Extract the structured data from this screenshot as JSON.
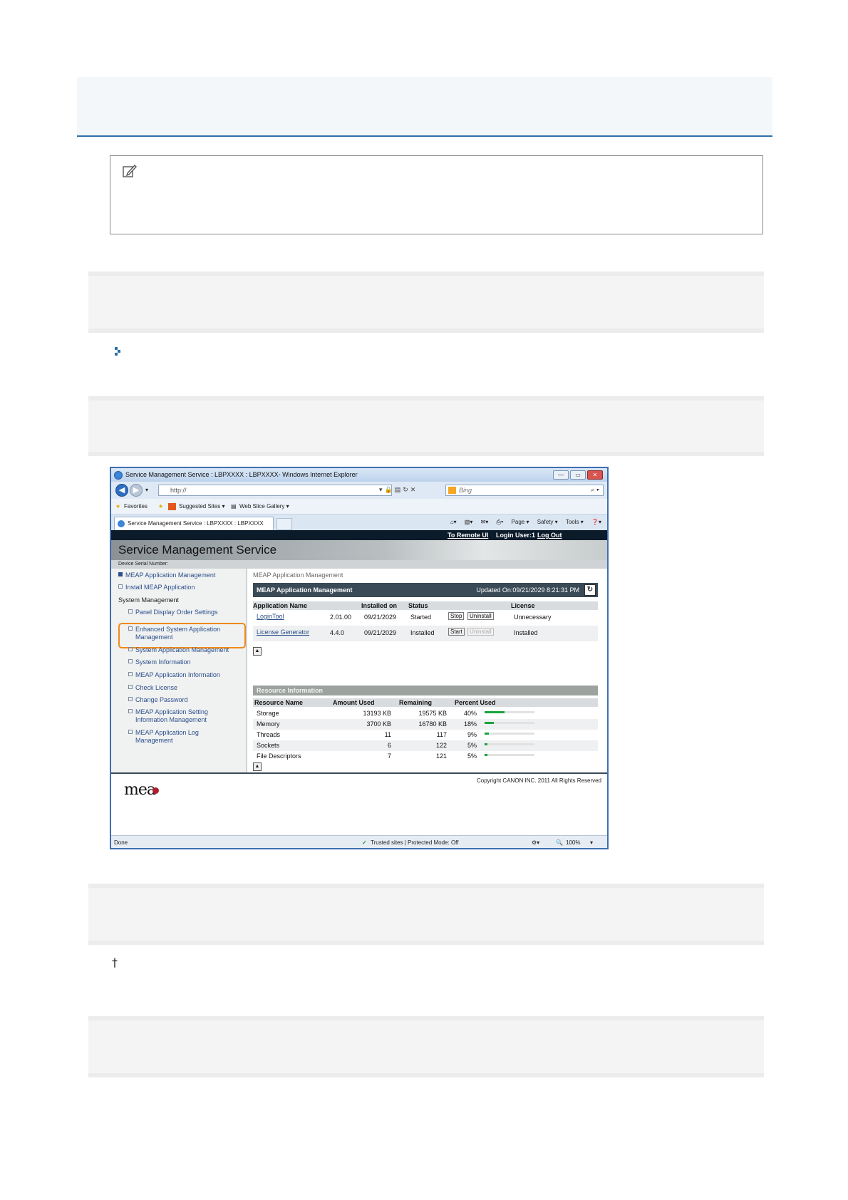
{
  "window": {
    "title": "Service Management Service : LBPXXXX : LBPXXXX- Windows Internet Explorer",
    "address": "http://",
    "search_placeholder": "Bing"
  },
  "favorites": {
    "favorites_label": "Favorites",
    "suggested_sites": "Suggested Sites ▾",
    "web_slice_gallery": "Web Slice Gallery ▾"
  },
  "tab": {
    "title": "Service Management Service : LBPXXXX : LBPXXXX"
  },
  "commandbar": {
    "page": "Page ▾",
    "safety": "Safety ▾",
    "tools": "Tools ▾",
    "help": "❓▾"
  },
  "page": {
    "remote_ui": "To Remote UI",
    "login_user": "Login User:1",
    "logout": "Log Out",
    "service_title": "Service Management Service",
    "serial_label": "Device Serial Number:"
  },
  "sidebar": {
    "meap_app_mgmt": "MEAP Application Management",
    "install_meap": "Install MEAP Application",
    "system_mgmt": "System Management",
    "panel_display": "Panel Display Order Settings",
    "enhanced_line1": "Enhanced System Application",
    "enhanced_line2": "Management",
    "system_app_mgmt": "System Application Management",
    "system_info": "System Information",
    "meap_app_info": "MEAP Application Information",
    "check_license": "Check License",
    "change_password": "Change Password",
    "setting_line1": "MEAP Application Setting",
    "setting_line2": "Information Management",
    "log_line1": "MEAP Application Log",
    "log_line2": "Management"
  },
  "content": {
    "breadcrumb": "MEAP Application Management",
    "header_title": "MEAP Application Management",
    "updated": "Updated On:09/21/2029 8:21:31 PM",
    "app_columns": {
      "name": "Application Name",
      "installed_on": "Installed on",
      "status": "Status",
      "license": "License"
    },
    "apps": [
      {
        "name": "LoginTool",
        "version": "2.01.00",
        "installed_on": "09/21/2029",
        "status": "Started",
        "action": "Stop",
        "uninstall": "Uninstall",
        "license": "Unnecessary"
      },
      {
        "name": "License Generator",
        "version": "4.4.0",
        "installed_on": "09/21/2029",
        "status": "Installed",
        "action": "Start",
        "uninstall": "Uninstall",
        "license": "Installed"
      }
    ],
    "resource_header": "Resource Information",
    "res_columns": {
      "name": "Resource Name",
      "used": "Amount Used",
      "remaining": "Remaining",
      "percent": "Percent Used"
    },
    "resources": [
      {
        "name": "Storage",
        "used": "13193 KB",
        "remaining": "19575 KB",
        "percent": "40%",
        "fraction": 0.4
      },
      {
        "name": "Memory",
        "used": "3700 KB",
        "remaining": "16780 KB",
        "percent": "18%",
        "fraction": 0.18
      },
      {
        "name": "Threads",
        "used": "11",
        "remaining": "117",
        "percent": "9%",
        "fraction": 0.09
      },
      {
        "name": "Sockets",
        "used": "6",
        "remaining": "122",
        "percent": "5%",
        "fraction": 0.05
      },
      {
        "name": "File Descriptors",
        "used": "7",
        "remaining": "121",
        "percent": "5%",
        "fraction": 0.05
      }
    ],
    "copyright": "Copyright CANON INC. 2011 All Rights Reserved",
    "logo": "mea"
  },
  "statusbar": {
    "done": "Done",
    "zone": "Trusted sites | Protected Mode: Off",
    "zoom": "100%"
  },
  "colors": {
    "accent_blue": "#2b6fa8",
    "highlight_orange": "#f08a1c",
    "bar_green": "#1aa33b"
  }
}
